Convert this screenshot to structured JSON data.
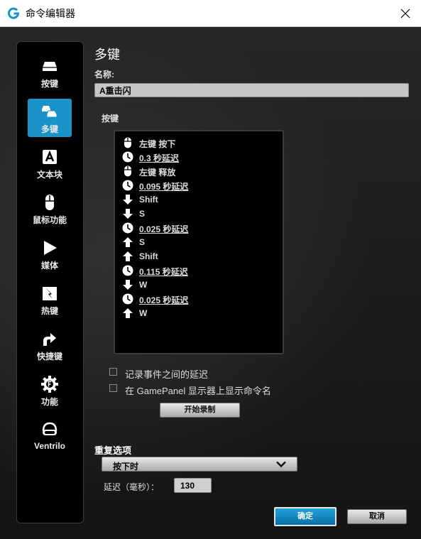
{
  "window": {
    "title": "命令编辑器",
    "app_icon": "logitech-g-icon",
    "close_icon": "close-icon"
  },
  "sidebar": {
    "items": [
      {
        "label": "按键",
        "icon": "keycap-icon",
        "active": false
      },
      {
        "label": "多键",
        "icon": "multikey-icon",
        "active": true
      },
      {
        "label": "文本块",
        "icon": "text-block-icon",
        "active": false
      },
      {
        "label": "鼠标功能",
        "icon": "mouse-icon",
        "active": false
      },
      {
        "label": "媒体",
        "icon": "play-icon",
        "active": false
      },
      {
        "label": "热键",
        "icon": "hotkey-icon",
        "active": false
      },
      {
        "label": "快捷键",
        "icon": "shortcut-arrow-icon",
        "active": false
      },
      {
        "label": "功能",
        "icon": "function-gear-icon",
        "active": false
      },
      {
        "label": "Ventrilo",
        "icon": "headset-icon",
        "active": false
      }
    ]
  },
  "main": {
    "heading": "多键",
    "name_label": "名称:",
    "name_value": "A重击闪",
    "keys_label": "按键",
    "events": [
      {
        "icon": "mouse-icon",
        "text": "左键 按下",
        "underline": false
      },
      {
        "icon": "clock-icon",
        "text": "0.3 秒延迟",
        "underline": true
      },
      {
        "icon": "mouse-icon",
        "text": "左键 释放",
        "underline": false
      },
      {
        "icon": "clock-icon",
        "text": "0.095 秒延迟",
        "underline": true
      },
      {
        "icon": "arrow-down-icon",
        "text": "Shift",
        "underline": false
      },
      {
        "icon": "arrow-down-icon",
        "text": "S",
        "underline": false
      },
      {
        "icon": "clock-icon",
        "text": "0.025 秒延迟",
        "underline": true
      },
      {
        "icon": "arrow-up-icon",
        "text": "S",
        "underline": false
      },
      {
        "icon": "arrow-up-icon",
        "text": "Shift",
        "underline": false
      },
      {
        "icon": "clock-icon",
        "text": "0.115 秒延迟",
        "underline": true
      },
      {
        "icon": "arrow-down-icon",
        "text": "W",
        "underline": false
      },
      {
        "icon": "clock-icon",
        "text": "0.025 秒延迟",
        "underline": true
      },
      {
        "icon": "arrow-up-icon",
        "text": "W",
        "underline": false
      }
    ],
    "checkbox_record_delays": {
      "label": "记录事件之间的延迟",
      "checked": false
    },
    "checkbox_gamepanel": {
      "label": "在 GamePanel 显示器上显示命令名",
      "checked": false
    },
    "record_button": "开始录制",
    "repeat_label": "重复选项",
    "repeat_selected": "按下时",
    "delay_label": "延迟（毫秒）：",
    "delay_value": "130"
  },
  "footer": {
    "ok_button": "确定",
    "cancel_button": "取消"
  },
  "colors": {
    "accent": "#1a93c9",
    "panel_bg": "#000000",
    "window_bg": "#1c1c1c"
  }
}
